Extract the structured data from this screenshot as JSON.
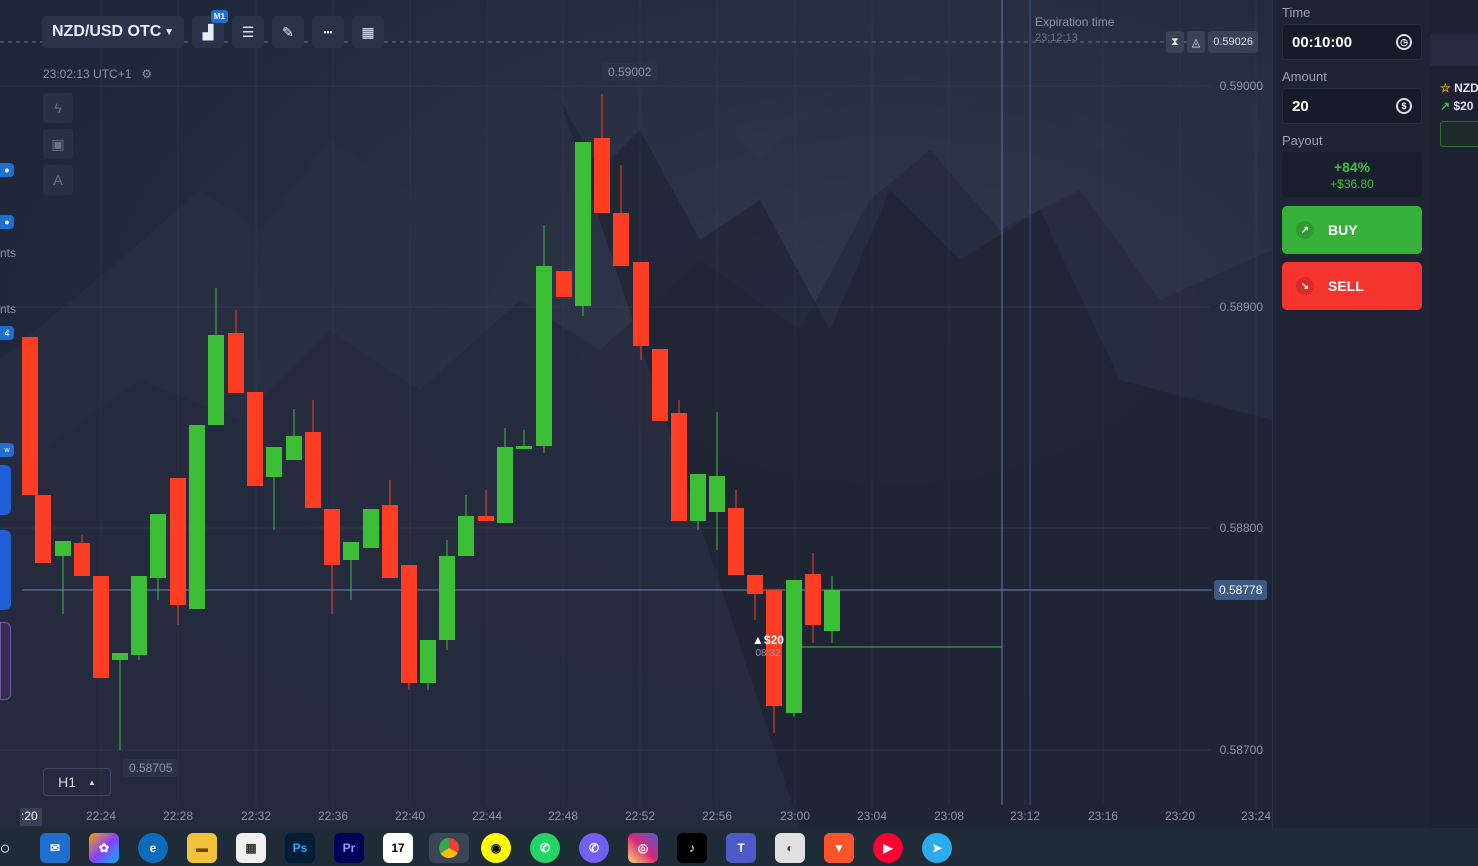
{
  "toolbar": {
    "pair": "NZD/USD OTC",
    "timeframe_badge": "M1"
  },
  "clock": "23:02:13 UTC+1",
  "expiration": {
    "label": "Expiration time",
    "time": "23:12:13"
  },
  "current_price": "0.59026",
  "live_price": "0.58778",
  "high_label": "0.59002",
  "low_label": "0.58705",
  "timeframe_selector": "H1",
  "left_strip": {
    "text1": "nts",
    "text2": "nts",
    "badge": "4",
    "badge2": "w"
  },
  "trade_marker": {
    "amount": "$20",
    "time": "08:32"
  },
  "price_axis": [
    "0.59000",
    "0.58900",
    "0.58800",
    "0.58700"
  ],
  "time_axis": [
    "22:24",
    "22:28",
    "22:32",
    "22:36",
    "22:40",
    "22:44",
    "22:48",
    "22:52",
    "22:56",
    "23:00",
    "23:04",
    "23:08",
    "23:12",
    "23:16",
    "23:20",
    "23:24"
  ],
  "time_axis_partial": ":20",
  "panel": {
    "time_label": "Time",
    "time_value": "00:10:00",
    "amount_label": "Amount",
    "amount_value": "20",
    "payout_label": "Payout",
    "payout_pct": "+84%",
    "payout_amount": "+$36.80",
    "buy_label": "BUY",
    "sell_label": "SELL"
  },
  "far_right": {
    "pair": "NZD",
    "amount": "$20"
  },
  "colors": {
    "up": "#3cbf36",
    "down": "#ff3d22",
    "buy": "#37b13a",
    "sell": "#f5332f",
    "accent": "#1f6fd1"
  },
  "chart_data": {
    "type": "candlestick",
    "ylim": [
      0.5868,
      0.5903
    ],
    "candles": [
      {
        "o": 0.5889,
        "h": 0.5889,
        "c": 0.5882,
        "l": 0.5882,
        "x": "22:21"
      },
      {
        "o": 0.5882,
        "h": 0.5882,
        "c": 0.5879,
        "l": 0.5878,
        "x": "22:21.5"
      },
      {
        "o": 0.58783,
        "h": 0.588,
        "c": 0.58789,
        "l": 0.58765,
        "x": "22:22"
      },
      {
        "o": 0.58789,
        "h": 0.58795,
        "c": 0.58774,
        "l": 0.5877,
        "x": "22:22.5"
      },
      {
        "o": 0.58774,
        "h": 0.58774,
        "c": 0.58728,
        "l": 0.58728,
        "x": "22:23"
      },
      {
        "o": 0.58725,
        "h": 0.58725,
        "c": 0.58728,
        "l": 0.587,
        "x": "22:23.5"
      },
      {
        "o": 0.5873,
        "h": 0.5879,
        "c": 0.58775,
        "l": 0.5872,
        "x": "22:24"
      },
      {
        "o": 0.58775,
        "h": 0.588,
        "c": 0.58803,
        "l": 0.5877,
        "x": "22:24.5"
      },
      {
        "o": 0.58813,
        "h": 0.5883,
        "c": 0.58768,
        "l": 0.5876,
        "x": "22:25"
      },
      {
        "o": 0.58768,
        "h": 0.58875,
        "c": 0.58837,
        "l": 0.58765,
        "x": "22:25.5"
      },
      {
        "o": 0.58837,
        "h": 0.5889,
        "c": 0.58865,
        "l": 0.58835,
        "x": "22:26"
      },
      {
        "o": 0.58865,
        "h": 0.5888,
        "c": 0.58837,
        "l": 0.5883,
        "x": "22:26.5"
      },
      {
        "o": 0.58837,
        "h": 0.5885,
        "c": 0.58808,
        "l": 0.58807,
        "x": "22:27"
      },
      {
        "o": 0.58808,
        "h": 0.58835,
        "c": 0.5882,
        "l": 0.588,
        "x": "22:27.5"
      },
      {
        "o": 0.58815,
        "h": 0.5882,
        "c": 0.58822,
        "l": 0.58805,
        "x": "22:28"
      },
      {
        "o": 0.58822,
        "h": 0.58825,
        "c": 0.58795,
        "l": 0.58785,
        "x": "22:28.5"
      },
      {
        "o": 0.58795,
        "h": 0.5882,
        "c": 0.5879,
        "l": 0.58776,
        "x": "22:29"
      },
      {
        "o": 0.5879,
        "h": 0.588,
        "c": 0.58798,
        "l": 0.58785,
        "x": "22:29.5"
      },
      {
        "o": 0.58798,
        "h": 0.5881,
        "c": 0.58815,
        "l": 0.5879,
        "x": "22:30"
      },
      {
        "o": 0.58815,
        "h": 0.5882,
        "c": 0.5877,
        "l": 0.5877,
        "x": "22:30.5"
      },
      {
        "o": 0.58762,
        "h": 0.5877,
        "c": 0.58718,
        "l": 0.5871,
        "x": "22:31"
      },
      {
        "o": 0.58718,
        "h": 0.5874,
        "c": 0.58736,
        "l": 0.58705,
        "x": "22:31.5"
      }
    ]
  }
}
